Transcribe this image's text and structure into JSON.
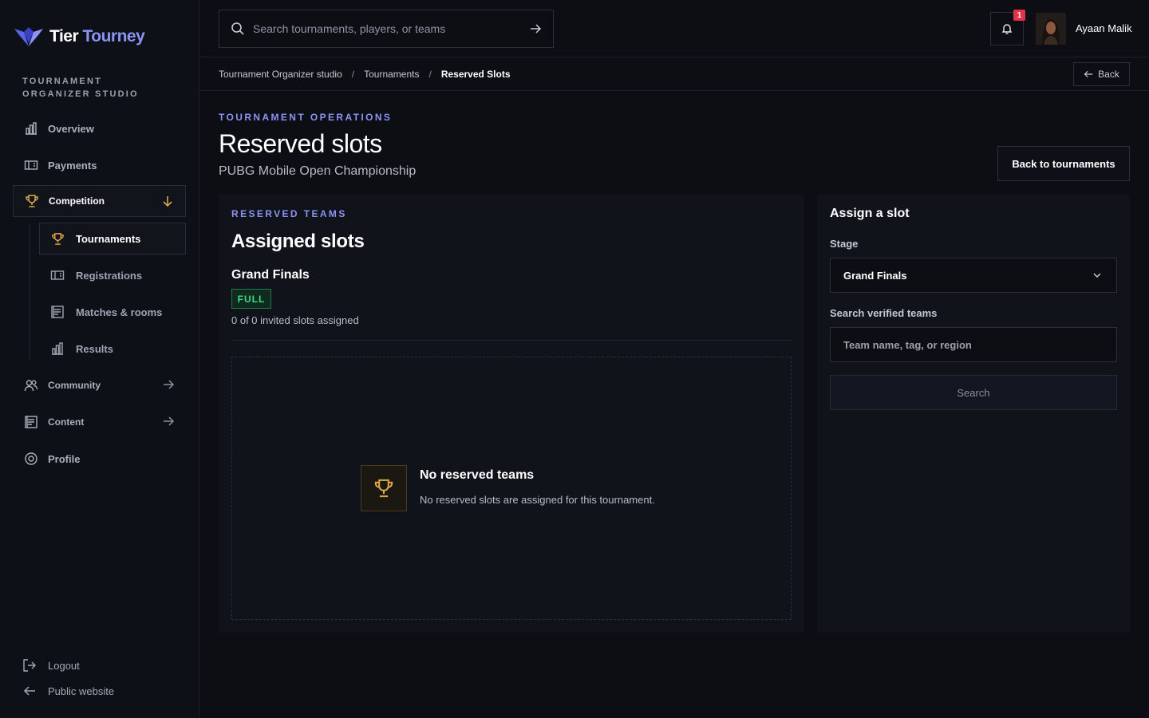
{
  "brand": {
    "name_part1": "Tier",
    "name_part2": "Tourney",
    "studio_label": "TOURNAMENT ORGANIZER STUDIO"
  },
  "sidebar": {
    "items": [
      {
        "label": "Overview",
        "icon": "bar-chart-icon"
      },
      {
        "label": "Payments",
        "icon": "ticket-icon"
      },
      {
        "label": "Competition",
        "icon": "trophy-icon",
        "expanded": true
      },
      {
        "label": "Community",
        "icon": "users-icon"
      },
      {
        "label": "Content",
        "icon": "document-icon"
      },
      {
        "label": "Profile",
        "icon": "settings-icon"
      }
    ],
    "sub_items": [
      {
        "label": "Tournaments",
        "icon": "trophy-icon",
        "active": true
      },
      {
        "label": "Registrations",
        "icon": "ticket-icon"
      },
      {
        "label": "Matches & rooms",
        "icon": "document-icon"
      },
      {
        "label": "Results",
        "icon": "bar-chart-icon"
      }
    ],
    "footer": {
      "logout": "Logout",
      "public_website": "Public website"
    }
  },
  "topbar": {
    "search_placeholder": "Search tournaments, players, or teams",
    "notification_count": "1",
    "user_name": "Ayaan Malik"
  },
  "breadcrumb": {
    "items": [
      "Tournament Organizer studio",
      "Tournaments",
      "Reserved Slots"
    ],
    "separator": "/",
    "back_label": "Back"
  },
  "header": {
    "eyebrow": "TOURNAMENT OPERATIONS",
    "title": "Reserved slots",
    "subtitle": "PUBG Mobile Open Championship",
    "back_button": "Back to tournaments"
  },
  "assigned": {
    "eyebrow": "RESERVED TEAMS",
    "title": "Assigned slots",
    "stage_name": "Grand Finals",
    "status_badge": "FULL",
    "slots_text": "0 of 0 invited slots assigned",
    "empty_title": "No reserved teams",
    "empty_desc": "No reserved slots are assigned for this tournament."
  },
  "assign": {
    "title": "Assign a slot",
    "stage_label": "Stage",
    "stage_value": "Grand Finals",
    "search_label": "Search verified teams",
    "search_placeholder": "Team name, tag, or region",
    "search_button": "Search"
  },
  "colors": {
    "accent": "#8b93f5",
    "success": "#3ddc84",
    "trophy": "#e0a84a",
    "badge": "#e0324a"
  }
}
